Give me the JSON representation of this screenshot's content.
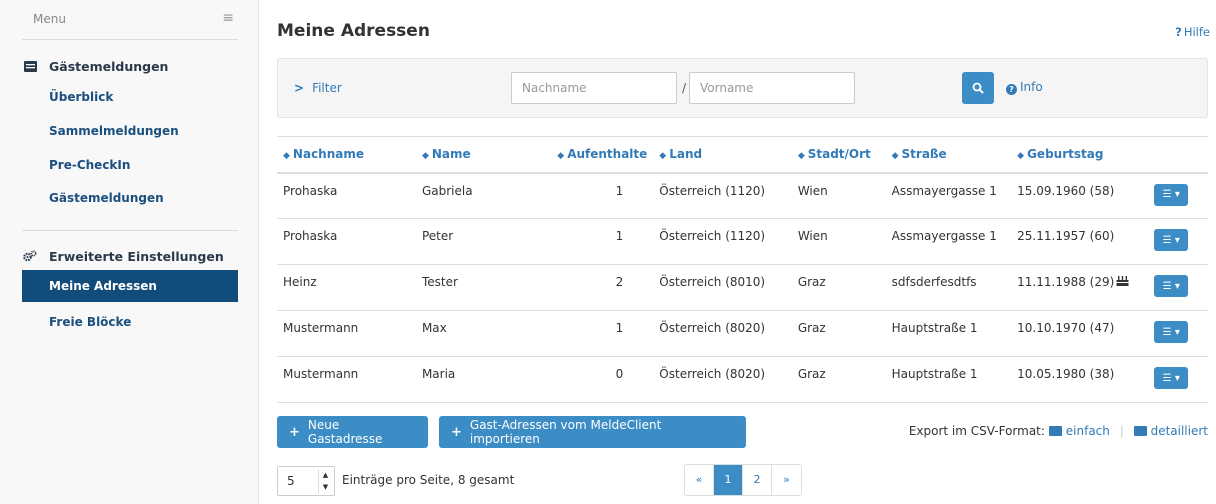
{
  "sidebar": {
    "menu_label": "Menu",
    "menu_toggle": "≡",
    "sections": [
      {
        "title": "Gästemeldungen",
        "items": [
          "Überblick",
          "Sammelmeldungen",
          "Pre-CheckIn",
          "Gästemeldungen"
        ]
      },
      {
        "title": "Erweiterte Einstellungen",
        "items": [
          "Meine Adressen",
          "Freie Blöcke"
        ]
      }
    ],
    "active_item": "Meine Adressen"
  },
  "header": {
    "title": "Meine Adressen",
    "help_icon": "?",
    "help_label": "Hilfe"
  },
  "filter": {
    "toggle_label": "Filter",
    "lastname_placeholder": "Nachname",
    "separator": "/",
    "firstname_placeholder": "Vorname",
    "info_label": "Info"
  },
  "table": {
    "columns": [
      "Nachname",
      "Name",
      "Aufenthalte",
      "Land",
      "Stadt/Ort",
      "Straße",
      "Geburtstag"
    ],
    "rows": [
      {
        "nachname": "Prohaska",
        "name": "Gabriela",
        "aufenthalte": "1",
        "land": "Österreich (1120)",
        "stadt": "Wien",
        "strasse": "Assmayergasse 1",
        "geburtstag": "15.09.1960 (58)"
      },
      {
        "nachname": "Prohaska",
        "name": "Peter",
        "aufenthalte": "1",
        "land": "Österreich (1120)",
        "stadt": "Wien",
        "strasse": "Assmayergasse 1",
        "geburtstag": "25.11.1957 (60)"
      },
      {
        "nachname": "Heinz",
        "name": "Tester",
        "aufenthalte": "2",
        "land": "Österreich (8010)",
        "stadt": "Graz",
        "strasse": "sdfsderfesdtfs",
        "geburtstag": "11.11.1988 (29)",
        "birthday_icon": true
      },
      {
        "nachname": "Mustermann",
        "name": "Max",
        "aufenthalte": "1",
        "land": "Österreich (8020)",
        "stadt": "Graz",
        "strasse": "Hauptstraße 1",
        "geburtstag": "10.10.1970 (47)"
      },
      {
        "nachname": "Mustermann",
        "name": "Maria",
        "aufenthalte": "0",
        "land": "Österreich (8020)",
        "stadt": "Graz",
        "strasse": "Hauptstraße 1",
        "geburtstag": "10.05.1980 (38)"
      }
    ]
  },
  "actions": {
    "new_address": "Neue Gastadresse",
    "import": "Gast-Adressen vom MeldeClient importieren"
  },
  "export": {
    "label": "Export im CSV-Format:",
    "simple": "einfach",
    "separator": "|",
    "detailed": "detailliert"
  },
  "pagination": {
    "per_page_value": "5",
    "per_page_text": "Einträge pro Seite, 8 gesamt",
    "prev": "«",
    "pages": [
      "1",
      "2"
    ],
    "current_page": "1",
    "next": "»"
  },
  "colors": {
    "accent": "#3c8dc5",
    "active_nav": "#124c7a",
    "link": "#337ab7"
  },
  "icons": {
    "section_1": "list-icon",
    "section_2": "cogs-icon",
    "row_action": "menu-dropdown-icon",
    "birthday": "birthday-cake-icon",
    "export": "folder-icon"
  }
}
